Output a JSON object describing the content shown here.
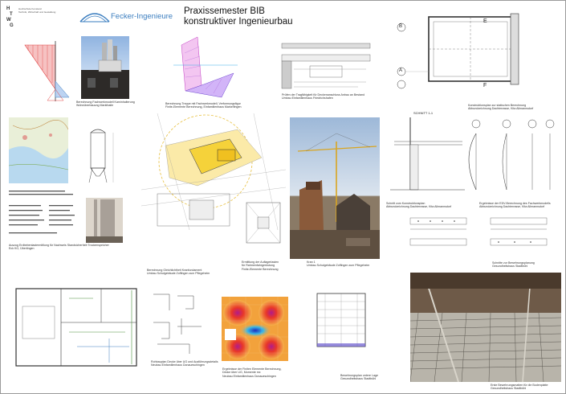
{
  "header": {
    "logo_letters": [
      "H",
      "T",
      "W",
      "G"
    ],
    "university_text": "Hochschule Konstanz\nTechnik, Wirtschaft und Gestaltung",
    "company_name": "Fecker-Ingenieure",
    "title_line1": "Praxissemester BIB",
    "title_line2": "konstruktiver Ingenieurbau"
  },
  "captions": {
    "c1": "Berechnung Fachwerkmodell Kaminhalterung\nWohnüberbauung Markthalle",
    "c2": "Berechnung Treppe mit Fachwerkmodell, Verformungsfigur\nFinite-Elemente Berechnung, Einfamilienhaus Markelfingen",
    "c3": "Prüfen der Tragfähigkeit für Deckenanschluss Anbau an Bestand\nUmbau Einfamilienhaus Friedrichshafen",
    "c4": "Konstruktionsplan zur statischen Berechnung\nAbbundzeichnung Dachterrasse, Kita Allmannsdorf",
    "c5": "Auszug Erdbebenlastermittlung für Nachweis Standsicherheit Trockenspeicher\nEck KG, Überlingen",
    "c6": "Berechnung Gleichlichtheit Kranfundament\nUmbau Schulgebäude Zoffingen zum Pflegeheim",
    "c7": "Ermittlung der Auflagerlasten\nfür Rahmenfahrgerüstung\nFinite-Elemente Berechnung",
    "c8": "Kran 1\nUmbau Schulgebäude Zoffingen zum Pflegeheim",
    "c9": "Schnitt zum Konstruktionsplan\nAbbundzeichnung Dachterrasse, Kita Allmannsdorf",
    "c10": "Ergebnisse der EDV-Berechnung des Fachwerkmodells\nAbbundzeichnung Dachterrasse, Kita Allmannsdorf",
    "c11": "Schnitte zur Bewehrungsplanung\nGesundheitshaus Stadtbühl",
    "c12": "Rohbauplan Decke über UG und Ausführungsdetails\nNeubau Einfamilienhaus Donaueschingen",
    "c13": "Ergebnisse der Finiten Elemente Berechnung,\nDecke über UG, Momente mx\nNeubau Einfamilienhaus Donaueschingen",
    "c14": "Bewehrungsplan untere Lage\nGesundheitshaus Stadtbühl",
    "c15": "Erste Bewehrungsmatten für die Bodenplatte\nGesundheitshaus Stadtbühl"
  },
  "labels": {
    "schnitt": "SCHNITT 1-1",
    "axis_a": "A",
    "axis_b": "B",
    "axis_e": "E",
    "axis_f": "F"
  },
  "colors": {
    "blue_accent": "#3a7dbf",
    "red_diagram": "#e04040",
    "yellow_site": "#f5d23a",
    "heatmap_red": "#e8362a"
  }
}
